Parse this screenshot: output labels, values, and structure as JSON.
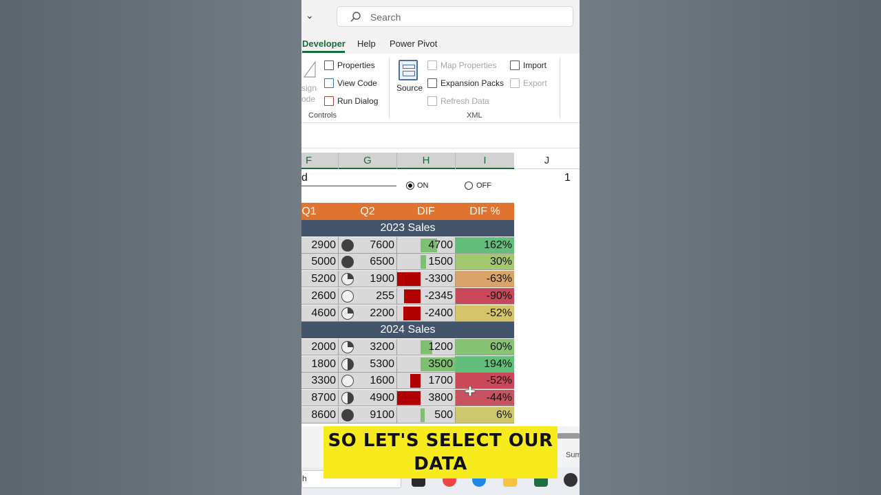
{
  "search": {
    "placeholder": "Search"
  },
  "tabs": [
    {
      "label": "Developer",
      "active": true
    },
    {
      "label": "Help",
      "active": false
    },
    {
      "label": "Power Pivot",
      "active": false
    }
  ],
  "ribbon": {
    "controls": {
      "design_mode_partial": "sign\node",
      "properties": "Properties",
      "view_code": "View Code",
      "run_dialog": "Run Dialog",
      "group_label": "Controls"
    },
    "xml": {
      "source": "Source",
      "map_properties": "Map Properties",
      "expansion_packs": "Expansion Packs",
      "refresh_data": "Refresh Data",
      "import": "Import",
      "export": "Export",
      "group_label": "XML"
    }
  },
  "columns": [
    "F",
    "G",
    "H",
    "I",
    "J"
  ],
  "control_row": {
    "label_partial": "d",
    "on_label": "ON",
    "off_label": "OFF",
    "j_value": "1"
  },
  "table": {
    "headers": [
      "Q1",
      "Q2",
      "DIF",
      "DIF %"
    ],
    "sections": [
      {
        "title": "2023 Sales",
        "rows": [
          {
            "q1": "2900",
            "harvey": "full",
            "q2": "7600",
            "dif": "4700",
            "pct": "162%",
            "pct_color": "#63be7b",
            "bar": 0.48
          },
          {
            "q1": "5000",
            "harvey": "full",
            "q2": "6500",
            "dif": "1500",
            "pct": "30%",
            "pct_color": "#a2c96f",
            "bar": 0.15
          },
          {
            "q1": "5200",
            "harvey": "quarter",
            "q2": "1900",
            "dif": "-3300",
            "pct": "-63%",
            "pct_color": "#d9a46a",
            "bar": -1.0
          },
          {
            "q1": "2600",
            "harvey": "empty",
            "q2": "255",
            "dif": "-2345",
            "pct": "-90%",
            "pct_color": "#c9485a",
            "bar": -0.72
          },
          {
            "q1": "4600",
            "harvey": "quarter",
            "q2": "2200",
            "dif": "-2400",
            "pct": "-52%",
            "pct_color": "#d4c46c",
            "bar": -0.75
          }
        ]
      },
      {
        "title": "2024 Sales",
        "rows": [
          {
            "q1": "2000",
            "harvey": "quarter",
            "q2": "3200",
            "dif": "1200",
            "pct": "60%",
            "pct_color": "#86c474",
            "bar": 0.34
          },
          {
            "q1": "1800",
            "harvey": "half",
            "q2": "5300",
            "dif": "3500",
            "pct": "194%",
            "pct_color": "#63be7b",
            "bar": 1.0
          },
          {
            "q1": "3300",
            "harvey": "empty",
            "q2": "1600",
            "dif": "1700",
            "pct": "-52%",
            "pct_color": "#c9485a",
            "bar": -0.45
          },
          {
            "q1": "8700",
            "harvey": "half",
            "q2": "4900",
            "dif": "3800",
            "pct": "-44%",
            "pct_color": "#c85360",
            "bar": -1.0
          },
          {
            "q1": "8600",
            "harvey": "full",
            "q2": "9100",
            "dif": "500",
            "pct": "6%",
            "pct_color": "#cdc86d",
            "bar": 0.12
          }
        ]
      }
    ]
  },
  "status": {
    "sum_partial": "Sum"
  },
  "taskbar": {
    "search_partial": "h"
  },
  "caption": {
    "line1": "SO LET'S SELECT OUR",
    "line2": "DATA"
  },
  "colors": {
    "header_orange": "#e0732f",
    "section_slate": "#44546a",
    "excel_green": "#1a6b3a",
    "caption_yellow": "#f7ea1d"
  }
}
